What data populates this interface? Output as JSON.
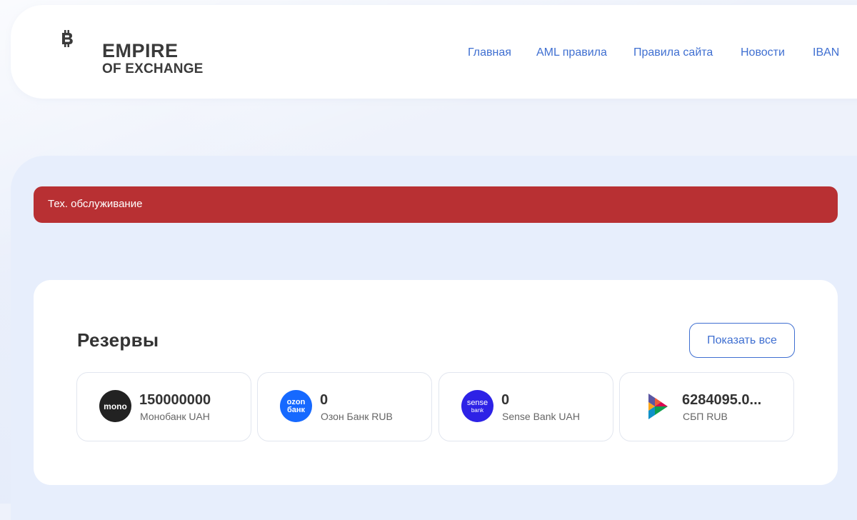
{
  "brand": {
    "logo_symbol": "₿",
    "name_line1": "EMPIRE",
    "name_line2": "OF EXCHANGE"
  },
  "nav": {
    "items": [
      {
        "label": "Главная"
      },
      {
        "label": "AML правила"
      },
      {
        "label": "Правила сайта"
      },
      {
        "label": "Новости"
      },
      {
        "label": "IBAN"
      }
    ]
  },
  "alert": {
    "text": "Тех. обслуживание",
    "color": "#b83033"
  },
  "reserves": {
    "title": "Резервы",
    "show_all_label": "Показать все",
    "items": [
      {
        "amount": "150000000",
        "name": "Монобанк UAH",
        "icon": "mono-logo-icon",
        "icon_text": "mono",
        "icon_color": "#222222"
      },
      {
        "amount": "0",
        "name": "Озон Банк RUB",
        "icon": "ozon-bank-logo-icon",
        "icon_text_1": "ozon",
        "icon_text_2": "банк",
        "icon_color": "#1669ff"
      },
      {
        "amount": "0",
        "name": "Sense Bank UAH",
        "icon": "sense-bank-logo-icon",
        "icon_text_1": "sense",
        "icon_text_2": "bank",
        "icon_color": "#2d22e6"
      },
      {
        "amount": "6284095.0...",
        "name": "СБП RUB",
        "icon": "sbp-logo-icon"
      }
    ]
  },
  "colors": {
    "accent": "#3f6fd1",
    "text_dark": "#333333",
    "page_bg": "#eef2fb"
  }
}
